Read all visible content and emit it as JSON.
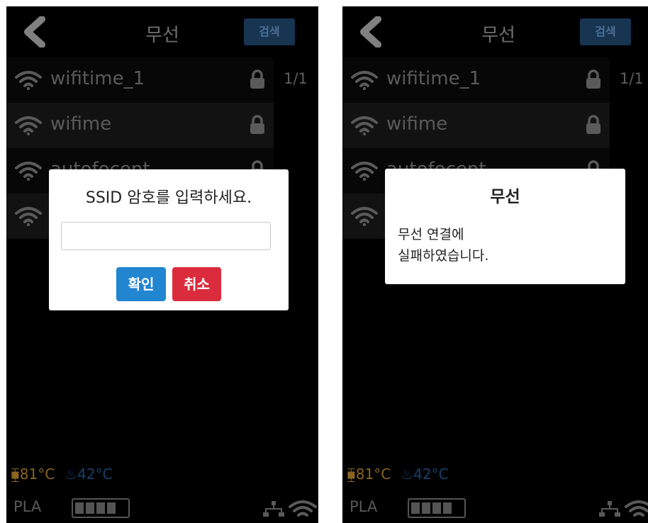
{
  "header": {
    "title": "무선",
    "search_label": "검색"
  },
  "page_indicator": "1/1",
  "networks": [
    {
      "ssid": "wifitime_1",
      "locked": true
    },
    {
      "ssid": "wifime",
      "locked": true
    },
    {
      "ssid": "autofocent",
      "locked": true
    },
    {
      "ssid": "",
      "locked": false
    }
  ],
  "status": {
    "nozzle_temp": "81°C",
    "bed_temp": "42°C",
    "filament": "PLA",
    "filament_level_bars": 4
  },
  "password_dialog": {
    "title": "SSID 암호를 입력하세요.",
    "input_value": "",
    "confirm_label": "확인",
    "cancel_label": "취소"
  },
  "fail_dialog": {
    "title": "무선",
    "message_line1": "무선 연결에",
    "message_line2": "실패하였습니다."
  },
  "colors": {
    "confirm": "#2185d0",
    "cancel": "#db2c3d",
    "search_button": "#173451",
    "nozzle": "#8a6420",
    "bed": "#19406a"
  }
}
